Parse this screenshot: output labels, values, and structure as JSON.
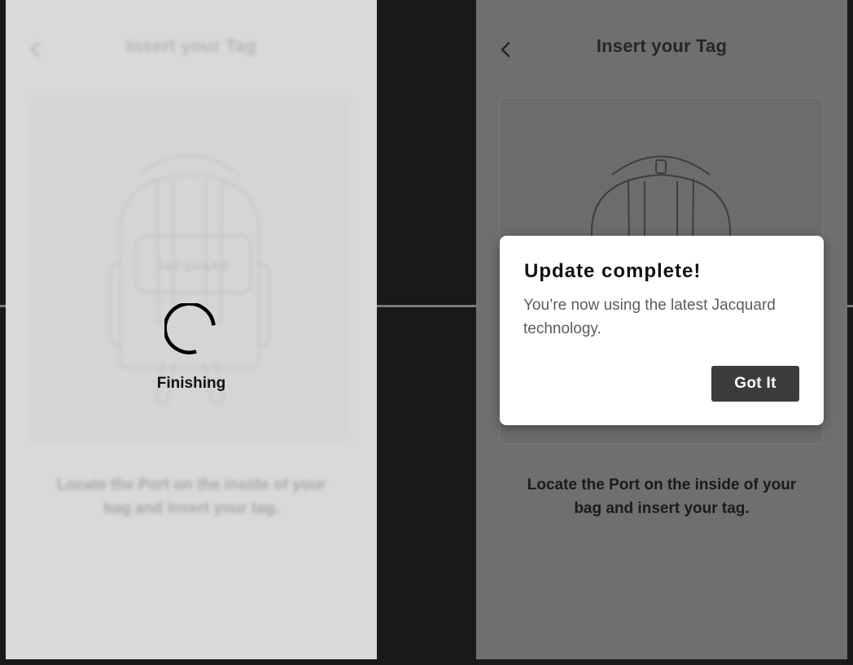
{
  "colors": {
    "background": "#191919",
    "left_screen_bg": "#d9d9d9",
    "right_screen_scrim": "#6f6f6f",
    "dialog_bg": "#ffffff",
    "button_bg": "#3c3c3c",
    "button_text": "#ffffff"
  },
  "left_screen": {
    "header": {
      "back_icon": "chevron-left-icon",
      "title": "Insert your Tag"
    },
    "illustration": {
      "icon": "backpack-icon",
      "patch_text": "JACQUARD"
    },
    "instruction": "Locate the Port on the inside of your bag and insert your tag.",
    "loading": {
      "icon": "spinner-icon",
      "status": "Finishing"
    }
  },
  "right_screen": {
    "header": {
      "back_icon": "chevron-left-icon",
      "title": "Insert your Tag"
    },
    "illustration": {
      "icon": "backpack-icon"
    },
    "instruction": "Locate the Port on the inside of your bag and insert your tag.",
    "dialog": {
      "title": "Update complete!",
      "body": "You’re now using the latest Jacquard technology.",
      "button_label": "Got It"
    }
  }
}
